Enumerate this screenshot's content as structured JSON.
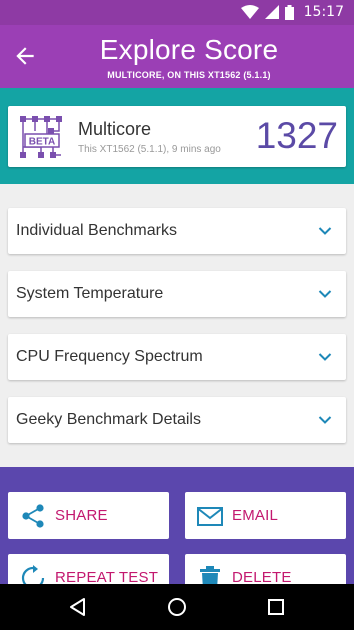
{
  "status_bar": {
    "time": "15:17"
  },
  "app_bar": {
    "title": "Explore Score",
    "subtitle": "MULTICORE, ON THIS XT1562 (5.1.1)"
  },
  "score_card": {
    "logo_text": "BETA",
    "label": "Multicore",
    "meta": "This XT1562 (5.1.1), 9 mins ago",
    "value": "1327"
  },
  "sections": [
    {
      "label": "Individual Benchmarks"
    },
    {
      "label": "System Temperature"
    },
    {
      "label": "CPU Frequency Spectrum"
    },
    {
      "label": "Geeky Benchmark Details"
    }
  ],
  "actions": {
    "share": "SHARE",
    "email": "EMAIL",
    "repeat": "REPEAT TEST",
    "delete": "DELETE"
  },
  "colors": {
    "app_bar": "#9b3fb5",
    "status_bar": "#8e3aa4",
    "teal": "#14a4a4",
    "action_band": "#5b47ad",
    "score": "#5b4aa6",
    "accent_text": "#c3186f",
    "chevron": "#1e88b8"
  },
  "icons": [
    "wifi-icon",
    "signal-icon",
    "battery-icon",
    "back-arrow-icon",
    "beta-logo-icon",
    "chevron-down-icon",
    "share-icon",
    "email-icon",
    "repeat-icon",
    "trash-icon",
    "nav-back-icon",
    "nav-home-icon",
    "nav-recents-icon"
  ]
}
